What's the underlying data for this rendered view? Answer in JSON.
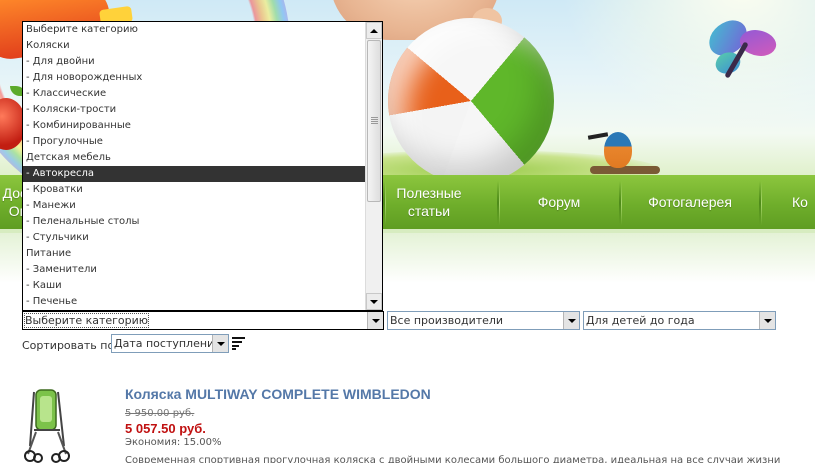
{
  "nav": {
    "items": [
      {
        "id": "dostavka",
        "label": "Дост\nОп"
      },
      {
        "id": "poleznye-stati",
        "label": "Полезные\nстатьи"
      },
      {
        "id": "forum",
        "label": "Форум"
      },
      {
        "id": "fotogalereya",
        "label": "Фотогалерея"
      },
      {
        "id": "more",
        "label": "Ко"
      }
    ]
  },
  "filters": {
    "category": {
      "selected": "Выберите категорию"
    },
    "manufacturer": {
      "selected": "Все производители"
    },
    "age": {
      "selected": "Для детей до года"
    }
  },
  "category_dropdown": {
    "options": [
      "Выберите категорию",
      "Коляски",
      " - Для двойни",
      " - Для новорожденных",
      " - Классические",
      " - Коляски-трости",
      " - Комбинированные",
      " - Прогулочные",
      "Детская мебель",
      " - Автокресла",
      " - Кроватки",
      " - Манежи",
      " - Пеленальные столы",
      " - Стульчики",
      "Питание",
      " - Заменители",
      " - Каши",
      " - Печенье"
    ],
    "highlighted": " - Автокресла"
  },
  "sort": {
    "label": "Сортировать по:",
    "selected": "Дата поступления",
    "icon": "sort-descending-icon"
  },
  "product": {
    "title": "Коляска MULTIWAY COMPLETE WIMBLEDON",
    "old_price": "5 950.00 руб.",
    "new_price": "5 057.50 руб.",
    "economy": "Экономия: 15.00%",
    "description": "Современная спортивная прогулочная коляска с двойными колесами большого диаметра, идеальная на все случаи жизни"
  },
  "colors": {
    "nav_green": "#6fae2b",
    "highlight": "#333333",
    "title_blue": "#5478a8",
    "price_red": "#c01010"
  }
}
